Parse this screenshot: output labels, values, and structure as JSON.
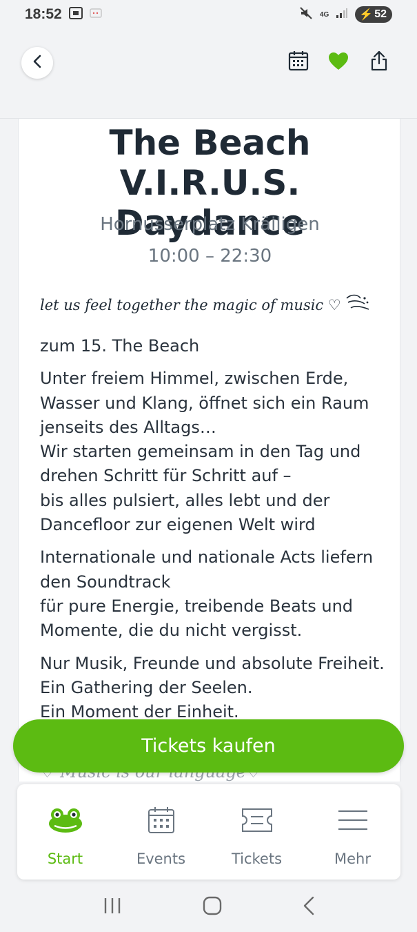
{
  "status_bar": {
    "time": "18:52",
    "network": "4G",
    "battery": "52"
  },
  "header": {
    "back_icon": "chevron-left-icon",
    "calendar_icon": "calendar-icon",
    "favorite_icon": "heart-icon",
    "share_icon": "share-icon",
    "favorite_color": "#5cbb12"
  },
  "event": {
    "title_line1": "The Beach V.I.R.U.S.",
    "title_line2": "Daydance",
    "venue": "Hornusserplatz Kräiligen",
    "time": "10:00 – 22:30",
    "tagline": "let us feel together the magic of music ♡",
    "paragraphs": [
      "zum 15. The Beach",
      "Unter freiem Himmel, zwischen Erde, Wasser und Klang, öffnet sich ein Raum jenseits des Alltags…",
      "Wir starten gemeinsam in den Tag und drehen Schritt für Schritt auf –",
      "bis alles pulsiert, alles lebt und der Dancefloor zur eigenen Welt wird",
      "Internationale und nationale Acts liefern den Soundtrack",
      "für pure Energie, treibende Beats und Momente, die du nicht vergisst.",
      "Nur Musik, Freunde und absolute Freiheit.",
      "Ein Gathering der Seelen.",
      "Ein Moment der Einheit."
    ],
    "faded_line": "♡ Music is our language♡"
  },
  "cta": {
    "label": "Tickets kaufen",
    "color": "#5cbb12"
  },
  "bottom_nav": [
    {
      "label": "Start",
      "icon": "frog-icon",
      "active": true
    },
    {
      "label": "Events",
      "icon": "calendar-icon",
      "active": false
    },
    {
      "label": "Tickets",
      "icon": "ticket-icon",
      "active": false
    },
    {
      "label": "Mehr",
      "icon": "menu-icon",
      "active": false
    }
  ],
  "system_nav": {
    "recents_icon": "recents-icon",
    "home_icon": "home-icon",
    "back_icon": "back-icon"
  }
}
